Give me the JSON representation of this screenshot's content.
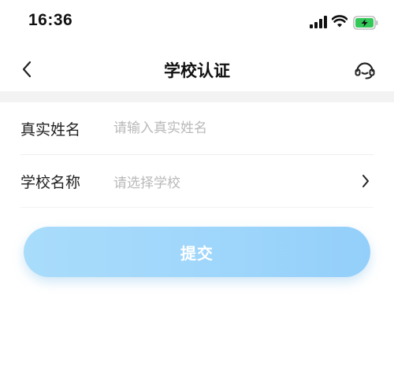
{
  "status_bar": {
    "time": "16:36",
    "battery_color": "#34c759"
  },
  "nav": {
    "title": "学校认证"
  },
  "form": {
    "name_label": "真实姓名",
    "name_placeholder": "请输入真实姓名",
    "name_value": "",
    "school_label": "学校名称",
    "school_placeholder": "请选择学校"
  },
  "submit": {
    "label": "提交",
    "color": "#9fd6fb"
  }
}
